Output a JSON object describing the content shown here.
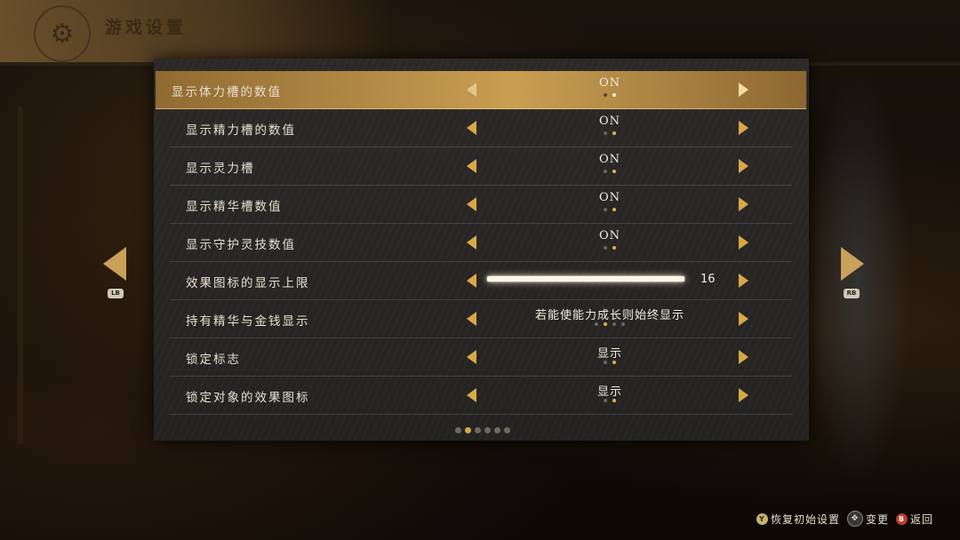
{
  "header": {
    "title": "游戏设置",
    "emblem_icon": "gear-emblem-icon"
  },
  "nav": {
    "left_badge": "LB",
    "right_badge": "RB"
  },
  "settings": [
    {
      "label": "显示体力槽的数值",
      "type": "toggle",
      "value": "ON",
      "options_count": 2,
      "selected_index": 1,
      "selected": true
    },
    {
      "label": "显示精力槽的数值",
      "type": "toggle",
      "value": "ON",
      "options_count": 2,
      "selected_index": 1
    },
    {
      "label": "显示灵力槽",
      "type": "toggle",
      "value": "ON",
      "options_count": 2,
      "selected_index": 1
    },
    {
      "label": "显示精华槽数值",
      "type": "toggle",
      "value": "ON",
      "options_count": 2,
      "selected_index": 1
    },
    {
      "label": "显示守护灵技数值",
      "type": "toggle",
      "value": "ON",
      "options_count": 2,
      "selected_index": 1
    },
    {
      "label": "效果图标的显示上限",
      "type": "slider",
      "value": "16",
      "fill_fraction": 1.0
    },
    {
      "label": "持有精华与金钱显示",
      "type": "select",
      "value": "若能使能力成长则始终显示",
      "options_count": 4,
      "selected_index": 1
    },
    {
      "label": "锁定标志",
      "type": "toggle",
      "value": "显示",
      "options_count": 2,
      "selected_index": 1
    },
    {
      "label": "锁定对象的效果图标",
      "type": "toggle",
      "value": "显示",
      "options_count": 2,
      "selected_index": 1
    }
  ],
  "pagination": {
    "count": 6,
    "active_index": 1
  },
  "footer": {
    "reset": {
      "button": "Y",
      "label": "恢复初始设置"
    },
    "change": {
      "button": "✥",
      "label": "变更"
    },
    "back": {
      "button": "B",
      "label": "返回"
    }
  },
  "colors": {
    "accent": "#d9a845",
    "selected_row": "#c9984a",
    "panel": "#2a2826"
  }
}
